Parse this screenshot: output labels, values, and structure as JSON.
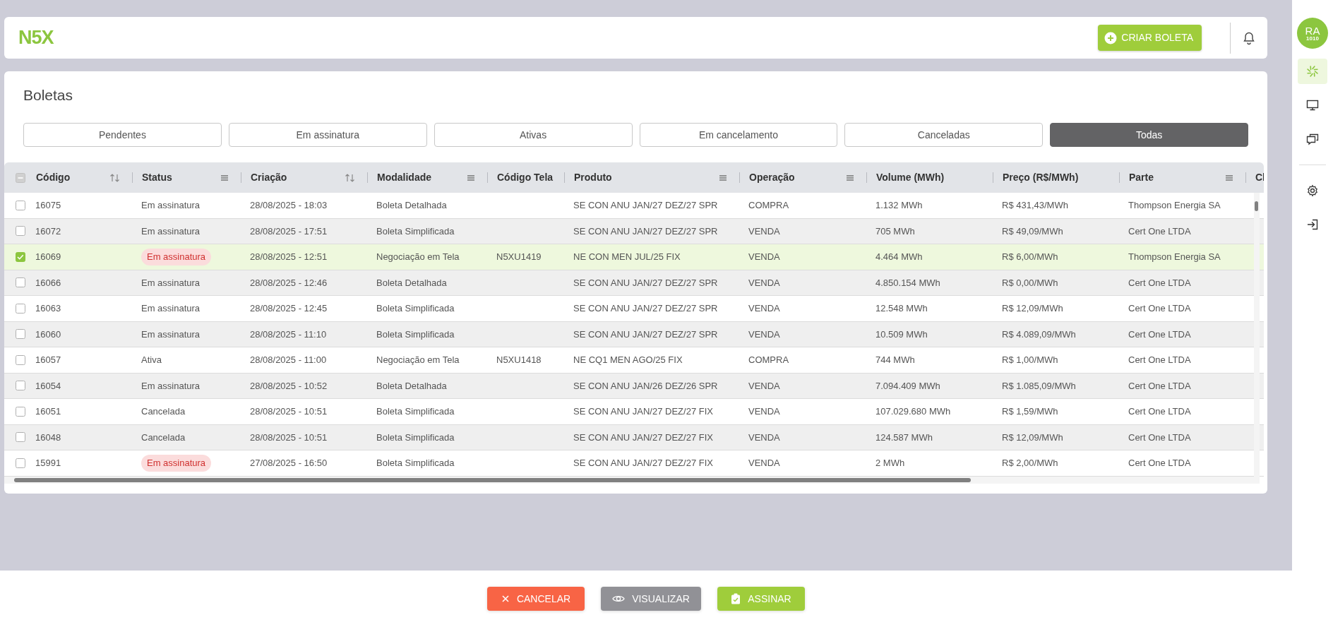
{
  "header": {
    "logo": "N5X",
    "create_button": "CRIAR BOLETA"
  },
  "user": {
    "initials": "RA",
    "code": "1010"
  },
  "sidebar": {
    "top": [
      {
        "kind": "spinner",
        "selected": true
      },
      {
        "kind": "monitor",
        "selected": false
      },
      {
        "kind": "chat",
        "selected": false
      }
    ],
    "bottom": [
      {
        "kind": "gear",
        "selected": false
      },
      {
        "kind": "logout",
        "selected": false
      }
    ]
  },
  "page": {
    "title": "Boletas"
  },
  "filters": [
    {
      "label": "Pendentes",
      "selected": false
    },
    {
      "label": "Em assinatura",
      "selected": false
    },
    {
      "label": "Ativas",
      "selected": false
    },
    {
      "label": "Em cancelamento",
      "selected": false
    },
    {
      "label": "Canceladas",
      "selected": false
    },
    {
      "label": "Todas",
      "selected": true
    }
  ],
  "table": {
    "header_partial": true,
    "columns": [
      {
        "label": "Código",
        "kind": "sort"
      },
      {
        "label": "Status",
        "kind": "menu"
      },
      {
        "label": "Criação",
        "kind": "sort"
      },
      {
        "label": "Modalidade",
        "kind": "menu"
      },
      {
        "label": "Código Tela"
      },
      {
        "label": "Produto",
        "kind": "menu"
      },
      {
        "label": "Operação",
        "kind": "menu"
      },
      {
        "label": "Volume (MWh)"
      },
      {
        "label": "Preço (R$/MWh)"
      },
      {
        "label": "Parte",
        "kind": "menu"
      },
      {
        "label": "Cl"
      }
    ],
    "rows": [
      {
        "selected": false,
        "status_badge": false,
        "codigo": "16075",
        "status": "Em assinatura",
        "criacao": "28/08/2025 - 18:03",
        "modalidade": "Boleta Detalhada",
        "produto": "SE CON ANU JAN/27 DEZ/27 SPR",
        "operacao": "COMPRA",
        "volume": "1.132 MWh",
        "preco": "R$ 431,43/MWh",
        "parte": "Thompson Energia SA"
      },
      {
        "selected": false,
        "status_badge": false,
        "codigo": "16072",
        "status": "Em assinatura",
        "criacao": "28/08/2025 - 17:51",
        "modalidade": "Boleta Simplificada",
        "produto": "SE CON ANU JAN/27 DEZ/27 SPR",
        "operacao": "VENDA",
        "volume": "705 MWh",
        "preco": "R$ 49,09/MWh",
        "parte": "Cert One LTDA"
      },
      {
        "selected": true,
        "status_badge": true,
        "codigo": "16069",
        "status": "Em assinatura",
        "criacao": "28/08/2025 - 12:51",
        "modalidade": "Negociação em Tela",
        "codigo_tela": "N5XU1419",
        "produto": "NE CON MEN JUL/25 FIX",
        "operacao": "VENDA",
        "volume": "4.464 MWh",
        "preco": "R$ 6,00/MWh",
        "parte": "Thompson Energia SA"
      },
      {
        "selected": false,
        "status_badge": false,
        "codigo": "16066",
        "status": "Em assinatura",
        "criacao": "28/08/2025 - 12:46",
        "modalidade": "Boleta Detalhada",
        "produto": "SE CON ANU JAN/27 DEZ/27 SPR",
        "operacao": "VENDA",
        "volume": "4.850.154 MWh",
        "preco": "R$ 0,00/MWh",
        "parte": "Cert One LTDA"
      },
      {
        "selected": false,
        "status_badge": false,
        "codigo": "16063",
        "status": "Em assinatura",
        "criacao": "28/08/2025 - 12:45",
        "modalidade": "Boleta Simplificada",
        "produto": "SE CON ANU JAN/27 DEZ/27 SPR",
        "operacao": "VENDA",
        "volume": "12.548 MWh",
        "preco": "R$ 12,09/MWh",
        "parte": "Cert One LTDA"
      },
      {
        "selected": false,
        "status_badge": false,
        "codigo": "16060",
        "status": "Em assinatura",
        "criacao": "28/08/2025 - 11:10",
        "modalidade": "Boleta Simplificada",
        "produto": "SE CON ANU JAN/27 DEZ/27 SPR",
        "operacao": "VENDA",
        "volume": "10.509 MWh",
        "preco": "R$ 4.089,09/MWh",
        "parte": "Cert One LTDA"
      },
      {
        "selected": false,
        "status_badge": false,
        "codigo": "16057",
        "status": "Ativa",
        "criacao": "28/08/2025 - 11:00",
        "modalidade": "Negociação em Tela",
        "codigo_tela": "N5XU1418",
        "produto": "NE CQ1 MEN AGO/25 FIX",
        "operacao": "COMPRA",
        "volume": "744 MWh",
        "preco": "R$ 1,00/MWh",
        "parte": "Cert One LTDA"
      },
      {
        "selected": false,
        "status_badge": false,
        "codigo": "16054",
        "status": "Em assinatura",
        "criacao": "28/08/2025 - 10:52",
        "modalidade": "Boleta Detalhada",
        "produto": "SE CON ANU JAN/26 DEZ/26 SPR",
        "operacao": "VENDA",
        "volume": "7.094.409 MWh",
        "preco": "R$ 1.085,09/MWh",
        "parte": "Cert One LTDA"
      },
      {
        "selected": false,
        "status_badge": false,
        "codigo": "16051",
        "status": "Cancelada",
        "criacao": "28/08/2025 - 10:51",
        "modalidade": "Boleta Simplificada",
        "produto": "SE CON ANU JAN/27 DEZ/27 FIX",
        "operacao": "VENDA",
        "volume": "107.029.680 MWh",
        "preco": "R$ 1,59/MWh",
        "parte": "Cert One LTDA"
      },
      {
        "selected": false,
        "status_badge": false,
        "codigo": "16048",
        "status": "Cancelada",
        "criacao": "28/08/2025 - 10:51",
        "modalidade": "Boleta Simplificada",
        "produto": "SE CON ANU JAN/27 DEZ/27 FIX",
        "operacao": "VENDA",
        "volume": "124.587 MWh",
        "preco": "R$ 12,09/MWh",
        "parte": "Cert One LTDA"
      },
      {
        "selected": false,
        "status_badge": true,
        "codigo": "15991",
        "status": "Em assinatura",
        "criacao": "27/08/2025 - 16:50",
        "modalidade": "Boleta Simplificada",
        "produto": "SE CON ANU JAN/27 DEZ/27 FIX",
        "operacao": "VENDA",
        "volume": "2 MWh",
        "preco": "R$ 2,00/MWh",
        "parte": "Cert One LTDA"
      }
    ]
  },
  "actions": [
    {
      "label": "CANCELAR",
      "kind": "cancel"
    },
    {
      "label": "VISUALIZAR",
      "kind": "view"
    },
    {
      "label": "ASSINAR",
      "kind": "sign"
    }
  ]
}
